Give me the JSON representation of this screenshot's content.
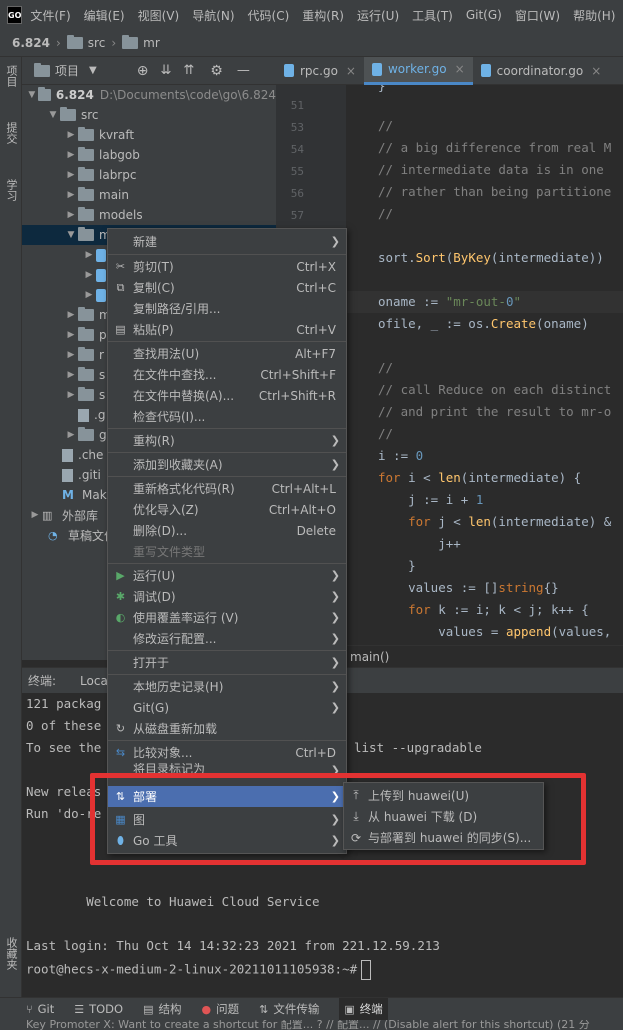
{
  "menubar": {
    "logo": "GO",
    "items": [
      "文件(F)",
      "编辑(E)",
      "视图(V)",
      "导航(N)",
      "代码(C)",
      "重构(R)",
      "运行(U)",
      "工具(T)",
      "Git(G)",
      "窗口(W)",
      "帮助(H)"
    ]
  },
  "breadcrumb": [
    "6.824",
    "src",
    "mr"
  ],
  "left_toolwindows": [
    "项目",
    "提交",
    "学习"
  ],
  "left_toolwindows_bottom": "收藏夹",
  "project_panel": {
    "title": "项目",
    "root_name": "6.824",
    "root_path": "D:\\Documents\\code\\go\\6.824",
    "tree": [
      {
        "label": "src",
        "depth": 1
      },
      {
        "label": "kvraft",
        "depth": 2
      },
      {
        "label": "labgob",
        "depth": 2
      },
      {
        "label": "labrpc",
        "depth": 2
      },
      {
        "label": "main",
        "depth": 2
      },
      {
        "label": "models",
        "depth": 2
      },
      {
        "label": "m",
        "depth": 2
      },
      {
        "label": "",
        "depth": 3
      },
      {
        "label": "",
        "depth": 3
      },
      {
        "label": "",
        "depth": 3
      },
      {
        "label": "m",
        "depth": 2
      },
      {
        "label": "p",
        "depth": 2
      },
      {
        "label": "r",
        "depth": 2
      },
      {
        "label": "s",
        "depth": 2
      },
      {
        "label": "s",
        "depth": 2
      },
      {
        "label": ".g",
        "depth": 2
      },
      {
        "label": "g",
        "depth": 2
      },
      {
        "label": ".che",
        "depth": 1
      },
      {
        "label": ".giti",
        "depth": 1
      },
      {
        "label": "Mak",
        "depth": 1
      },
      {
        "label": "外部库",
        "depth": 0
      },
      {
        "label": "草稿文件",
        "depth": 0
      }
    ]
  },
  "editor_tabs": [
    {
      "label": "rpc.go",
      "active": false
    },
    {
      "label": "worker.go",
      "active": true
    },
    {
      "label": "coordinator.go",
      "active": false
    }
  ],
  "editor": {
    "line_numbers": [
      "51",
      "53",
      "54",
      "55",
      "56",
      "57"
    ],
    "lines": [
      "}",
      "",
      "//",
      "// a big difference from real M",
      "// intermediate data is in one",
      "// rather than being partitione",
      "//",
      "",
      "sort.Sort(ByKey(intermediate))",
      "",
      "oname := \"mr-out-0\"",
      "ofile, _ := os.Create(oname)",
      "",
      "//",
      "// call Reduce on each distinct",
      "// and print the result to mr-o",
      "//",
      "i := 0",
      "for i < len(intermediate) {",
      "    j := i + 1",
      "    for j < len(intermediate) &",
      "        j++",
      "    }",
      "    values := []string{}",
      "    for k := i; k < j; k++ {",
      "        values = append(values,"
    ],
    "breadcrumb": "main()"
  },
  "terminal": {
    "label": "终端:",
    "tab": "Local",
    "lines": [
      "121 packag",
      "0 of these",
      "To see the",
      "",
      "New releas",
      "Run 'do-re",
      "",
      "",
      "",
      "        Welcome to Huawei Cloud Service",
      "",
      "Last login: Thu Oct 14 14:32:23 2021 from 221.12.59.213",
      "root@hecs-x-medium-2-linux-20211011105938:~#"
    ],
    "line3_suffix": "list --upgradable"
  },
  "context_menu": [
    {
      "label": "新建",
      "submenu": true,
      "icon": ""
    },
    {
      "sep": true
    },
    {
      "label": "剪切(T)",
      "shortcut": "Ctrl+X",
      "icon": "✂"
    },
    {
      "label": "复制(C)",
      "shortcut": "Ctrl+C",
      "icon": "⧉"
    },
    {
      "label": "复制路径/引用...",
      "icon": ""
    },
    {
      "label": "粘贴(P)",
      "shortcut": "Ctrl+V",
      "icon": "📋"
    },
    {
      "sep": true
    },
    {
      "label": "查找用法(U)",
      "shortcut": "Alt+F7",
      "icon": ""
    },
    {
      "label": "在文件中查找...",
      "shortcut": "Ctrl+Shift+F",
      "icon": ""
    },
    {
      "label": "在文件中替换(A)...",
      "shortcut": "Ctrl+Shift+R",
      "icon": ""
    },
    {
      "label": "检查代码(I)...",
      "icon": ""
    },
    {
      "sep": true
    },
    {
      "label": "重构(R)",
      "submenu": true,
      "icon": ""
    },
    {
      "sep": true
    },
    {
      "label": "添加到收藏夹(A)",
      "submenu": true,
      "icon": ""
    },
    {
      "sep": true
    },
    {
      "label": "重新格式化代码(R)",
      "shortcut": "Ctrl+Alt+L",
      "icon": ""
    },
    {
      "label": "优化导入(Z)",
      "shortcut": "Ctrl+Alt+O",
      "icon": ""
    },
    {
      "label": "删除(D)...",
      "shortcut": "Delete",
      "icon": ""
    },
    {
      "label": "重写文件类型",
      "disabled": true,
      "icon": ""
    },
    {
      "sep": true
    },
    {
      "label": "运行(U)",
      "submenu": true,
      "icon": "▶",
      "icon_color": "#59a869"
    },
    {
      "label": "调试(D)",
      "submenu": true,
      "icon": "✱",
      "icon_color": "#59a869"
    },
    {
      "label": "使用覆盖率运行 (V)",
      "submenu": true,
      "icon": "◐",
      "icon_color": "#59a869"
    },
    {
      "label": "修改运行配置...",
      "submenu": true,
      "icon": ""
    },
    {
      "sep": true
    },
    {
      "label": "打开于",
      "submenu": true,
      "icon": ""
    },
    {
      "sep": true
    },
    {
      "label": "本地历史记录(H)",
      "submenu": true,
      "icon": ""
    },
    {
      "label": "Git(G)",
      "submenu": true,
      "icon": ""
    },
    {
      "label": "从磁盘重新加载",
      "icon": "↻"
    },
    {
      "sep": true
    },
    {
      "label": "比较对象...",
      "shortcut": "Ctrl+D",
      "icon": "⇆",
      "icon_color": "#4a88c7"
    },
    {
      "label": "将目录标记为",
      "submenu": true,
      "icon": ""
    },
    {
      "label": "部署",
      "submenu": true,
      "icon": "⇅",
      "highlight": true
    },
    {
      "label": "图",
      "submenu": true,
      "icon": "▦",
      "icon_color": "#4a88c7"
    },
    {
      "label": "Go 工具",
      "submenu": true,
      "icon": "⬮",
      "icon_color": "#6fb2e6"
    }
  ],
  "deploy_submenu": [
    {
      "label": "上传到 huawei(U)",
      "icon": "⤒"
    },
    {
      "label": "从 huawei 下载 (D)",
      "icon": "⤓"
    },
    {
      "label": "与部署到 huawei 的同步(S)...",
      "icon": "⟳"
    }
  ],
  "bottom_tools": [
    {
      "label": "Git",
      "icon": "⑂"
    },
    {
      "label": "TODO",
      "icon": "☰"
    },
    {
      "label": "结构",
      "icon": "▤"
    },
    {
      "label": "问题",
      "icon": "●",
      "icon_color": "#e05555"
    },
    {
      "label": "文件传输",
      "icon": "⇅"
    },
    {
      "label": "终端",
      "icon": "▣",
      "active": true
    }
  ],
  "status_text": "Key Promoter X: Want to create a shortcut for 配置... ? // 配置... // (Disable alert for this shortcut) (21 分",
  "colors": {
    "highlight": "#4b6eaf",
    "annotation_red": "#e33232",
    "keyword": "#cc7832",
    "string": "#6a8759",
    "function": "#ffc66d",
    "comment": "#808080"
  }
}
